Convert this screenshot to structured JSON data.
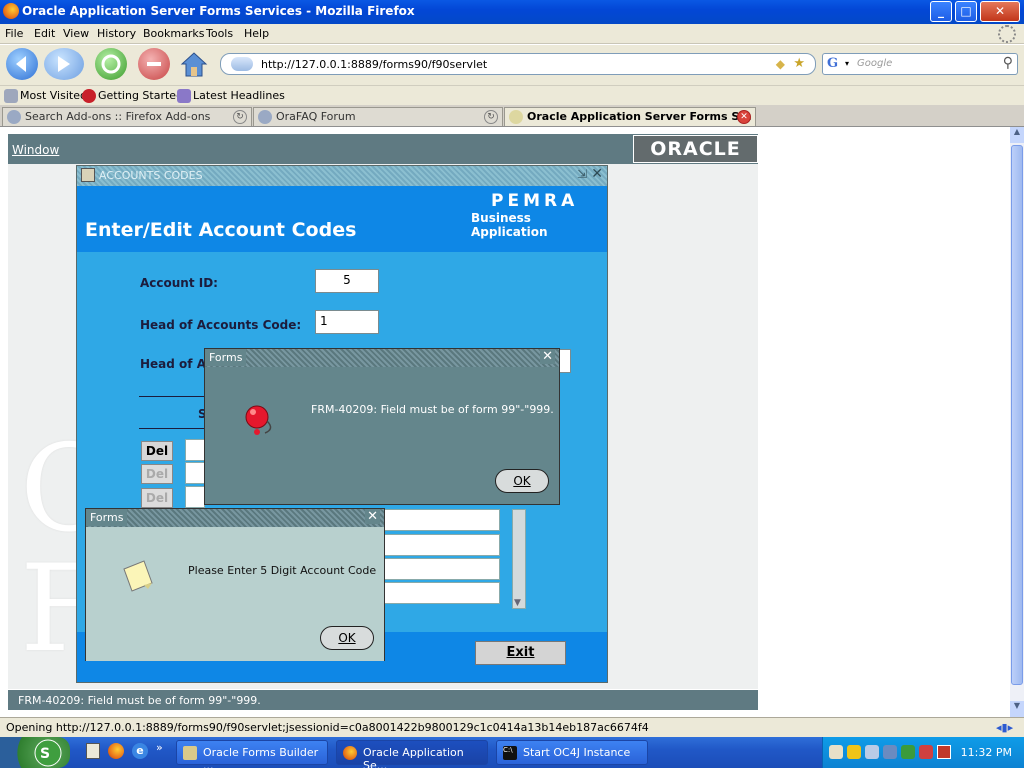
{
  "browser": {
    "window_title": "Oracle Application Server Forms Services - Mozilla Firefox",
    "window_buttons": [
      "_",
      "□",
      "✕"
    ],
    "menu": [
      "File",
      "Edit",
      "View",
      "History",
      "Bookmarks",
      "Tools",
      "Help"
    ],
    "url": "http://127.0.0.1:8889/forms90/f90servlet",
    "search_engine_glyph": "G",
    "search_placeholder": "Google",
    "bookmarks": [
      "Most Visited",
      "Getting Started",
      "Latest Headlines"
    ],
    "tabs": [
      {
        "label": "Search Add-ons :: Firefox Add-ons"
      },
      {
        "label": "OraFAQ Forum"
      },
      {
        "label": "Oracle Application Server Forms S..."
      }
    ],
    "status_text": "Opening http://127.0.0.1:8889/forms90/f90servlet;jsessionid=c0a8001422b9800129c1c0414a13b14eb187ac6674f4"
  },
  "forms": {
    "menu_window": "Window",
    "oracle_logo_text": "ORACLE",
    "window_title": "ACCOUNTS CODES",
    "header_title": "Enter/Edit Account Codes",
    "brand": "PEMRA",
    "brand_sub": "Business Application",
    "fields": {
      "account_id_label": "Account ID:",
      "account_id_value": "5",
      "head_code_label": "Head of Accounts Code:",
      "head_code_value": "1",
      "head_desc_label": "Head of A"
    },
    "subheader_letter": "S",
    "del_label": "Del",
    "exit_label": "Exit",
    "status_message": "FRM-40209: Field must be of form 99\"-\"999."
  },
  "dialogs": {
    "error": {
      "title": "Forms",
      "message": "FRM-40209: Field must be of form 99\"-\"999.",
      "ok": "OK"
    },
    "info": {
      "title": "Forms",
      "message": "Please Enter 5 Digit Account Code",
      "ok": "OK"
    }
  },
  "taskbar": {
    "tasks": [
      {
        "label": "Oracle Forms Builder ..."
      },
      {
        "label": "Oracle Application Se..."
      },
      {
        "label": "Start OC4J Instance"
      }
    ],
    "clock": "11:32 PM"
  },
  "colors": {
    "forms_blue": "#0e87e6",
    "forms_panel": "#2fa8e6",
    "dialog_gray": "#64868c",
    "xp_blue": "#0347d6"
  }
}
